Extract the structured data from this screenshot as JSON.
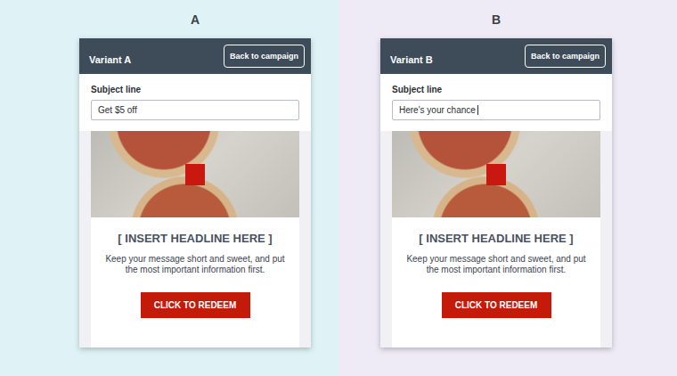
{
  "variants": [
    {
      "label": "A",
      "title": "Variant A",
      "back_button": "Back to campaign",
      "subject_label": "Subject line",
      "subject_value": "Get $5 off",
      "focused": false,
      "headline": "[ INSERT HEADLINE HERE ]",
      "body": "Keep your message short and sweet, and put the most important information first.",
      "cta": "CLICK TO REDEEM",
      "color": "#dff3f6"
    },
    {
      "label": "B",
      "title": "Variant B",
      "back_button": "Back to campaign",
      "subject_label": "Subject line",
      "subject_value": "Here's your chance",
      "focused": true,
      "headline": "[ INSERT HEADLINE HERE ]",
      "body": "Keep your message short and sweet, and put the most important information first.",
      "cta": "CLICK TO REDEEM",
      "color": "#eeebf7"
    }
  ]
}
